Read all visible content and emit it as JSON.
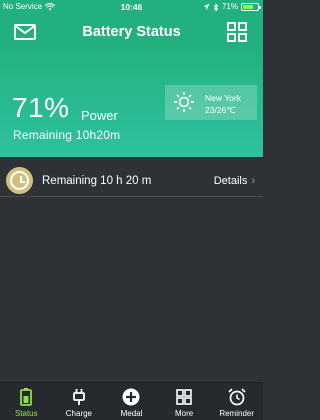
{
  "status_bar": {
    "carrier": "No Service",
    "time": "10:46",
    "battery_percent": "71%",
    "battery_level": 0.71
  },
  "header": {
    "title": "Battery Status"
  },
  "hero": {
    "percent": "71%",
    "power_label": "Power",
    "remaining": "Remaining 10h20m"
  },
  "weather": {
    "city": "New York",
    "temperature": "23/26℃"
  },
  "remaining_row": {
    "text": "Remaining 10 h 20 m",
    "details_label": "Details"
  },
  "tabs": [
    {
      "label": "Status",
      "icon": "battery-icon",
      "active": true
    },
    {
      "label": "Charge",
      "icon": "plug-icon",
      "active": false
    },
    {
      "label": "Medal",
      "icon": "medal-plus-icon",
      "active": false
    },
    {
      "label": "More",
      "icon": "grid-icon",
      "active": false
    },
    {
      "label": "Reminder",
      "icon": "alarm-clock-icon",
      "active": false
    }
  ],
  "colors": {
    "header_green": "#21b07e",
    "body_bg": "#2e3237",
    "active_tab": "#8de04a",
    "clock_badge": "#cfc07e"
  }
}
